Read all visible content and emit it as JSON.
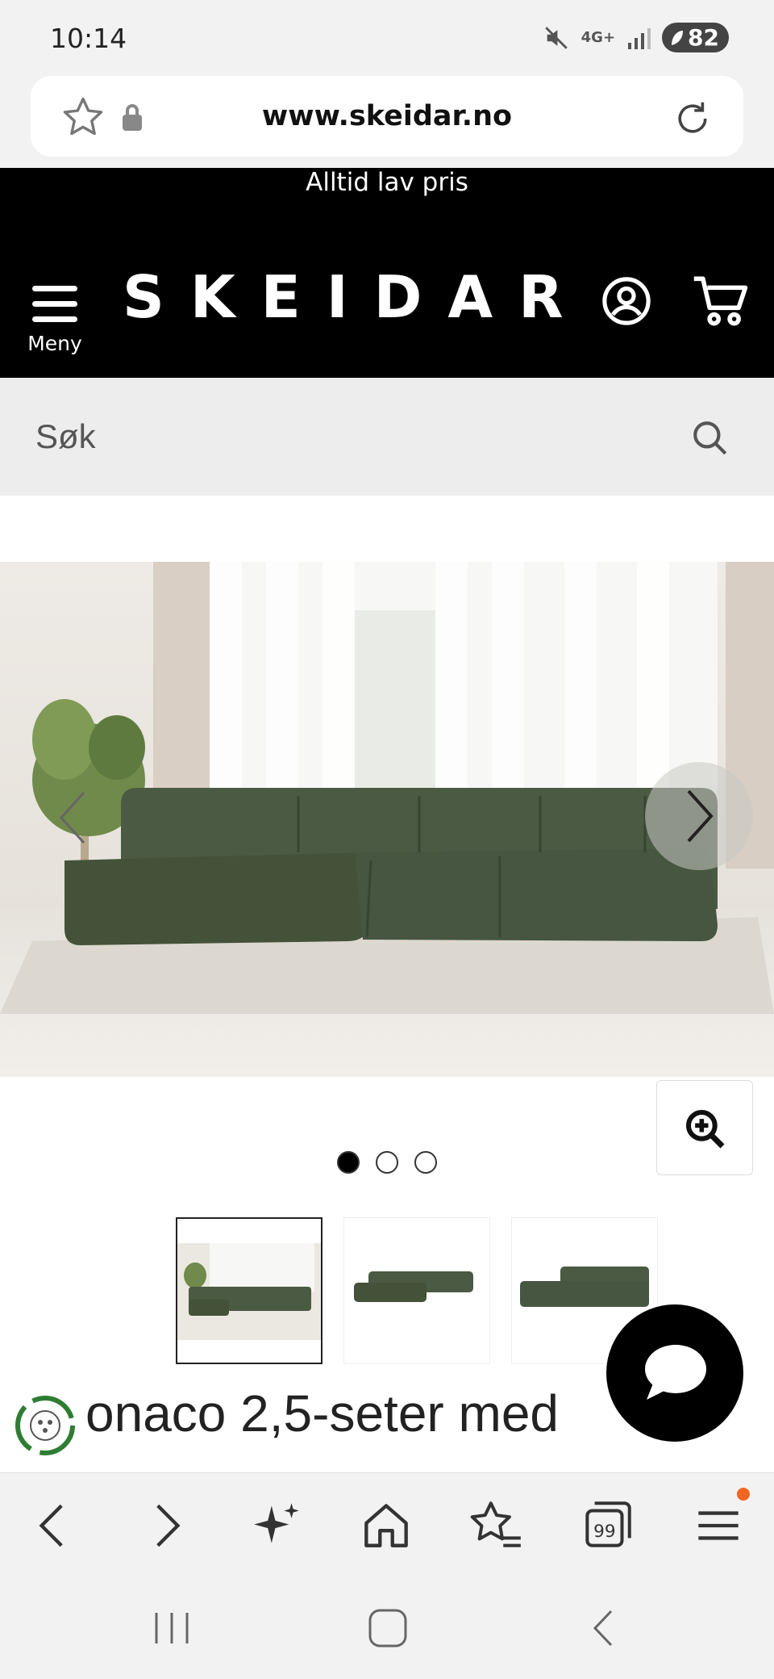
{
  "status_bar": {
    "time": "10:14",
    "network": "4G+",
    "battery": "82"
  },
  "browser": {
    "url": "www.skeidar.no"
  },
  "header": {
    "promo_text": "Alltid lav pris",
    "menu_label": "Meny",
    "logo_text": "SKEIDAR"
  },
  "search": {
    "placeholder": "Søk"
  },
  "product": {
    "carousel_dots": [
      true,
      false,
      false
    ],
    "thumbnails": [
      "thumb-1",
      "thumb-2",
      "thumb-3"
    ],
    "title_partial": "onaco 2,5-seter med"
  },
  "colors": {
    "sofa_green": "#4a5a43",
    "header_bg": "#000000",
    "eco_green": "#2e7d32",
    "notification_dot": "#f26522"
  }
}
